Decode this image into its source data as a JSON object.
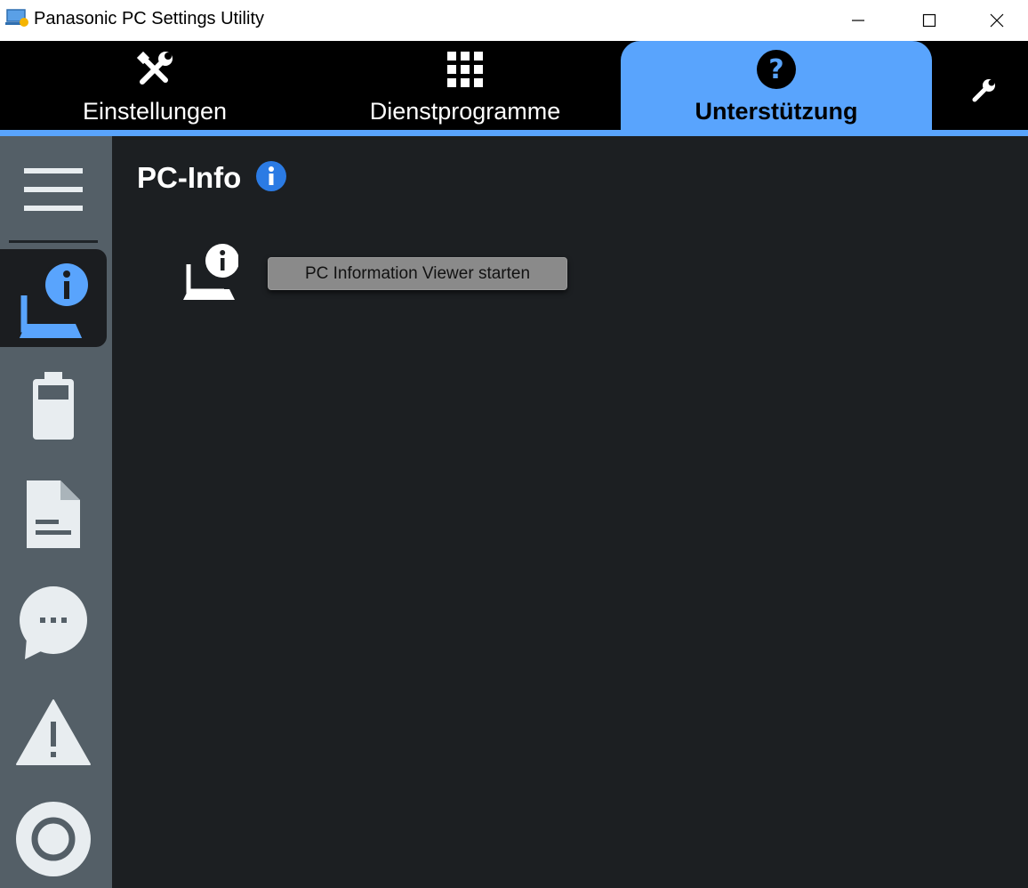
{
  "window": {
    "title": "Panasonic PC Settings Utility",
    "icons": [
      "app-icon",
      "minimize-icon",
      "maximize-icon",
      "close-icon"
    ]
  },
  "tabs": [
    {
      "label": "Einstellungen",
      "icon": "tools-icon",
      "active": false
    },
    {
      "label": "Dienstprogramme",
      "icon": "grid-icon",
      "active": false
    },
    {
      "label": "Unterstützung",
      "icon": "help-icon",
      "active": true
    }
  ],
  "toolbar": {
    "icon": "wrench-icon"
  },
  "sidebar": {
    "items": [
      {
        "icon": "menu-icon",
        "active": false
      },
      {
        "icon": "pc-info-icon",
        "active": true
      },
      {
        "icon": "battery-icon",
        "active": false
      },
      {
        "icon": "document-icon",
        "active": false
      },
      {
        "icon": "chat-icon",
        "active": false
      },
      {
        "icon": "warning-icon",
        "active": false
      },
      {
        "icon": "target-icon",
        "active": false
      }
    ]
  },
  "main": {
    "title": "PC-Info",
    "launch_button_label": "PC Information Viewer starten"
  },
  "colors": {
    "accent": "#59a4fd",
    "tabbar_bg": "#000000",
    "sidebar_bg": "#545f67",
    "content_bg": "#1c1f22",
    "info_blue": "#2b7be4"
  }
}
